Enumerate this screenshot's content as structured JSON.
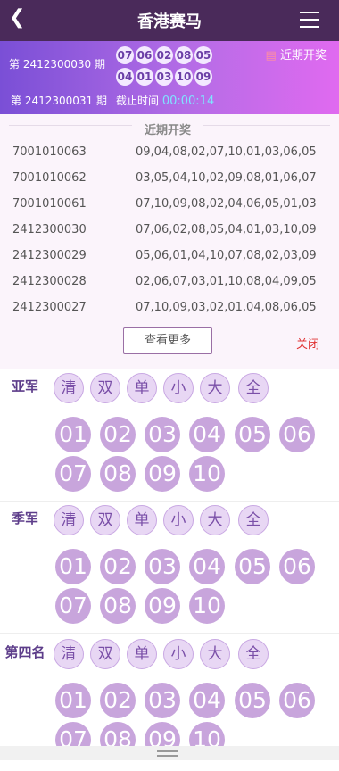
{
  "header": {
    "back_icon": "chevron-left-icon",
    "title": "香港赛马",
    "menu_icon": "hamburger-menu-icon"
  },
  "draw": {
    "current_period": "第 2412300030 期",
    "balls": [
      "07",
      "06",
      "02",
      "08",
      "05",
      "04",
      "01",
      "03",
      "10",
      "09"
    ],
    "recent_link": "近期开奖",
    "next_period": "第 2412300031 期",
    "deadline_label": "截止时间",
    "countdown": "00:00:14"
  },
  "recent": {
    "title": "近期开奖",
    "rows": [
      {
        "period": "7001010063",
        "numbers": "09,04,08,02,07,10,01,03,06,05"
      },
      {
        "period": "7001010062",
        "numbers": "03,05,04,10,02,09,08,01,06,07"
      },
      {
        "period": "7001010061",
        "numbers": "07,10,09,08,02,04,06,05,01,03"
      },
      {
        "period": "2412300030",
        "numbers": "07,06,02,08,05,04,01,03,10,09"
      },
      {
        "period": "2412300029",
        "numbers": "05,06,01,04,10,07,08,02,03,09"
      },
      {
        "period": "2412300028",
        "numbers": "02,06,07,03,01,10,08,04,09,05"
      },
      {
        "period": "2412300027",
        "numbers": "07,10,09,03,02,01,04,08,06,05"
      }
    ],
    "more_label": "查看更多",
    "close_label": "关闭"
  },
  "filters": [
    "清",
    "双",
    "单",
    "小",
    "大",
    "全"
  ],
  "numbers": [
    "01",
    "02",
    "03",
    "04",
    "05",
    "06",
    "07",
    "08",
    "09",
    "10"
  ],
  "sections": [
    {
      "label": "亚军"
    },
    {
      "label": "季军"
    },
    {
      "label": "第四名"
    }
  ],
  "colors": {
    "header_bg": "#4a2a5a",
    "ball_bg": "#c8a5dc",
    "pill_bg": "#e8d7f4",
    "close": "#e03030",
    "countdown": "#7fe3ff"
  }
}
